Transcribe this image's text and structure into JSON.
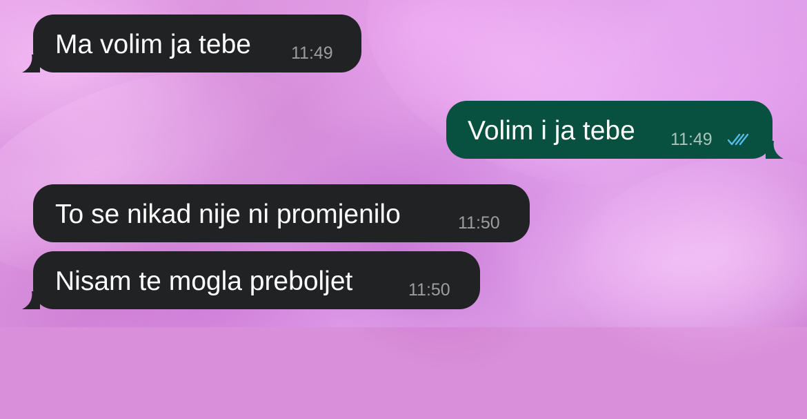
{
  "conversation": {
    "messages": [
      {
        "direction": "incoming",
        "text": "Ma volim ja tebe",
        "time": "11:49"
      },
      {
        "direction": "outgoing",
        "text": "Volim i ja tebe",
        "time": "11:49",
        "status": "read"
      },
      {
        "direction": "incoming",
        "text": "To se nikad nije ni promjenilo",
        "time": "11:50"
      },
      {
        "direction": "incoming",
        "text": "Nisam te mogla preboljet",
        "time": "11:50"
      }
    ]
  },
  "colors": {
    "incoming_bubble": "#202223",
    "outgoing_bubble": "#08503f",
    "read_ticks": "#53bdeb",
    "timestamp": "#9b9ea1",
    "wallpaper": "#d98fd9"
  },
  "icons": {
    "read_status": "double-check-icon"
  }
}
